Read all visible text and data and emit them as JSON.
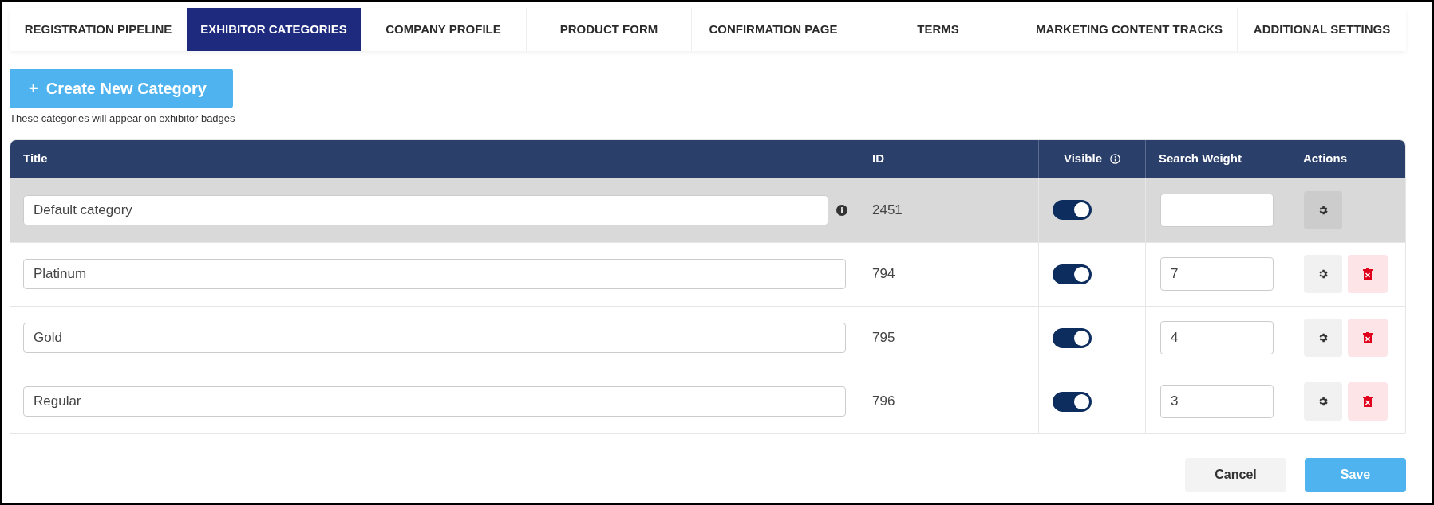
{
  "tabs": [
    {
      "label": "REGISTRATION PIPELINE",
      "selected": false
    },
    {
      "label": "EXHIBITOR CATEGORIES",
      "selected": true
    },
    {
      "label": "COMPANY PROFILE",
      "selected": false
    },
    {
      "label": "PRODUCT FORM",
      "selected": false
    },
    {
      "label": "CONFIRMATION PAGE",
      "selected": false
    },
    {
      "label": "TERMS",
      "selected": false
    },
    {
      "label": "MARKETING CONTENT TRACKS",
      "selected": false
    },
    {
      "label": "ADDITIONAL SETTINGS",
      "selected": false
    }
  ],
  "create_button": {
    "icon": "+",
    "label": "Create New Category"
  },
  "hint": "These categories will appear on exhibitor badges",
  "table": {
    "columns": [
      "Title",
      "ID",
      "Visible",
      "Search Weight",
      "Actions"
    ],
    "rows": [
      {
        "kind": "default",
        "title": "Default category",
        "id": "2451",
        "visible": true
      },
      {
        "kind": "custom",
        "title": "Platinum",
        "id": "794",
        "visible": true,
        "search_weight": "7"
      },
      {
        "kind": "custom",
        "title": "Gold",
        "id": "795",
        "visible": true,
        "search_weight": "4"
      },
      {
        "kind": "custom",
        "title": "Regular",
        "id": "796",
        "visible": true,
        "search_weight": "3"
      }
    ]
  },
  "footer": {
    "cancel": "Cancel",
    "save": "Save"
  }
}
